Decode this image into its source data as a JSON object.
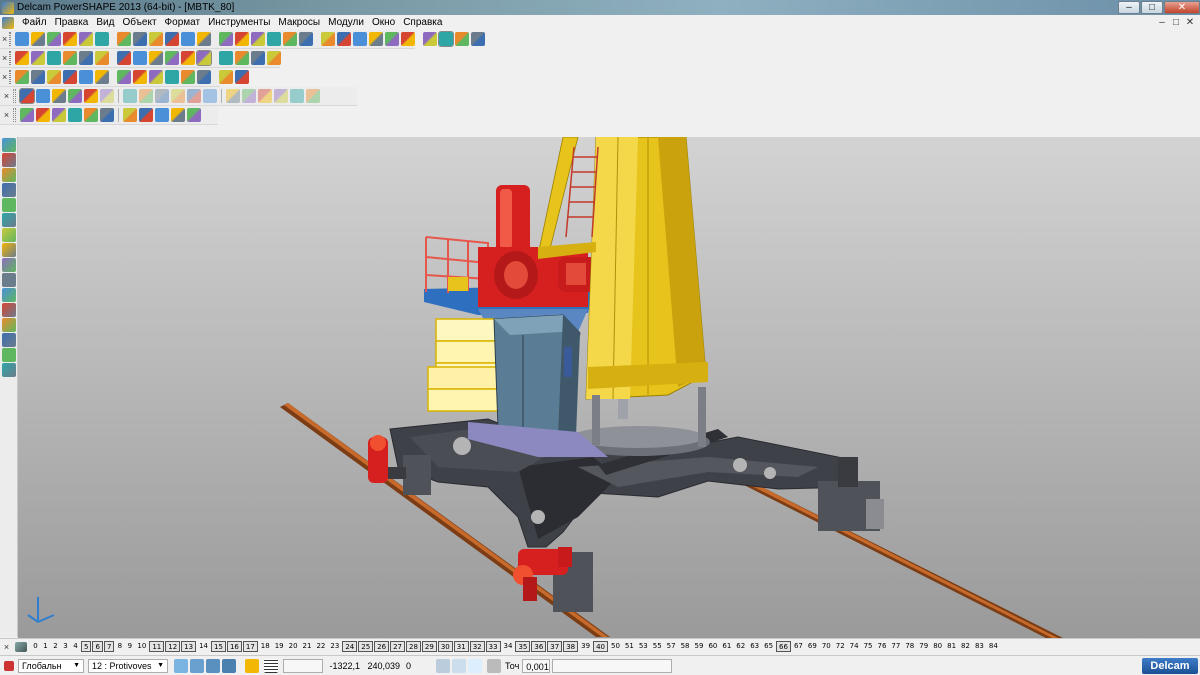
{
  "window": {
    "title": "Delcam PowerSHAPE 2013 (64-bit) - [MBTK_80]",
    "controls": [
      "–",
      "□",
      "✕"
    ]
  },
  "menu": {
    "items": [
      "Файл",
      "Правка",
      "Вид",
      "Объект",
      "Формат",
      "Инструменты",
      "Макросы",
      "Модули",
      "Окно",
      "Справка"
    ],
    "mdi_controls": [
      "–",
      "□",
      "✕"
    ]
  },
  "toolbars": {
    "close_glyph": "×",
    "row_counts": [
      28,
      16,
      14,
      18,
      11
    ]
  },
  "colors": {
    "crane_yellow": "#e7c41c",
    "motor_red": "#d6201f",
    "chassis": "#3f4149",
    "rail": "#a0521c",
    "cabinet": "#5a7d95",
    "platform_blue": "#2e6fbf",
    "selection_yellow": "#fff7c0"
  },
  "levels": [
    {
      "n": "0",
      "boxed": false
    },
    {
      "n": "1",
      "boxed": false
    },
    {
      "n": "2",
      "boxed": false
    },
    {
      "n": "3",
      "boxed": false
    },
    {
      "n": "4",
      "boxed": false
    },
    {
      "n": "5",
      "boxed": true
    },
    {
      "n": "6",
      "boxed": true
    },
    {
      "n": "7",
      "boxed": true
    },
    {
      "n": "8",
      "boxed": false
    },
    {
      "n": "9",
      "boxed": false
    },
    {
      "n": "10",
      "boxed": false
    },
    {
      "n": "11",
      "boxed": true
    },
    {
      "n": "12",
      "boxed": true
    },
    {
      "n": "13",
      "boxed": true
    },
    {
      "n": "14",
      "boxed": false
    },
    {
      "n": "15",
      "boxed": true
    },
    {
      "n": "16",
      "boxed": true
    },
    {
      "n": "17",
      "boxed": true
    },
    {
      "n": "18",
      "boxed": false
    },
    {
      "n": "19",
      "boxed": false
    },
    {
      "n": "20",
      "boxed": false
    },
    {
      "n": "21",
      "boxed": false
    },
    {
      "n": "22",
      "boxed": false
    },
    {
      "n": "23",
      "boxed": false
    },
    {
      "n": "24",
      "boxed": true
    },
    {
      "n": "25",
      "boxed": true
    },
    {
      "n": "26",
      "boxed": true
    },
    {
      "n": "27",
      "boxed": true
    },
    {
      "n": "28",
      "boxed": true
    },
    {
      "n": "29",
      "boxed": true
    },
    {
      "n": "30",
      "boxed": true
    },
    {
      "n": "31",
      "boxed": true
    },
    {
      "n": "32",
      "boxed": true
    },
    {
      "n": "33",
      "boxed": true
    },
    {
      "n": "34",
      "boxed": false
    },
    {
      "n": "35",
      "boxed": true
    },
    {
      "n": "36",
      "boxed": true
    },
    {
      "n": "37",
      "boxed": true
    },
    {
      "n": "38",
      "boxed": true
    },
    {
      "n": "39",
      "boxed": false
    },
    {
      "n": "40",
      "boxed": true
    },
    {
      "n": "50",
      "boxed": false
    },
    {
      "n": "51",
      "boxed": false
    },
    {
      "n": "53",
      "boxed": false
    },
    {
      "n": "55",
      "boxed": false
    },
    {
      "n": "57",
      "boxed": false
    },
    {
      "n": "58",
      "boxed": false
    },
    {
      "n": "59",
      "boxed": false
    },
    {
      "n": "60",
      "boxed": false
    },
    {
      "n": "61",
      "boxed": false
    },
    {
      "n": "62",
      "boxed": false
    },
    {
      "n": "63",
      "boxed": false
    },
    {
      "n": "65",
      "boxed": false
    },
    {
      "n": "66",
      "boxed": true
    },
    {
      "n": "67",
      "boxed": false
    },
    {
      "n": "69",
      "boxed": false
    },
    {
      "n": "70",
      "boxed": false
    },
    {
      "n": "72",
      "boxed": false
    },
    {
      "n": "74",
      "boxed": false
    },
    {
      "n": "75",
      "boxed": false
    },
    {
      "n": "76",
      "boxed": false
    },
    {
      "n": "77",
      "boxed": false
    },
    {
      "n": "78",
      "boxed": false
    },
    {
      "n": "79",
      "boxed": false
    },
    {
      "n": "80",
      "boxed": false
    },
    {
      "n": "81",
      "boxed": false
    },
    {
      "n": "82",
      "boxed": false
    },
    {
      "n": "83",
      "boxed": false
    },
    {
      "n": "84",
      "boxed": false
    }
  ],
  "status": {
    "workplane": "Глобальн",
    "level": "12 : Protivoves",
    "x": "-1322,1",
    "y": "240,039",
    "z": "0",
    "tolerance_label": "Точ",
    "tolerance_value": "0,001",
    "brand": "Delcam"
  }
}
